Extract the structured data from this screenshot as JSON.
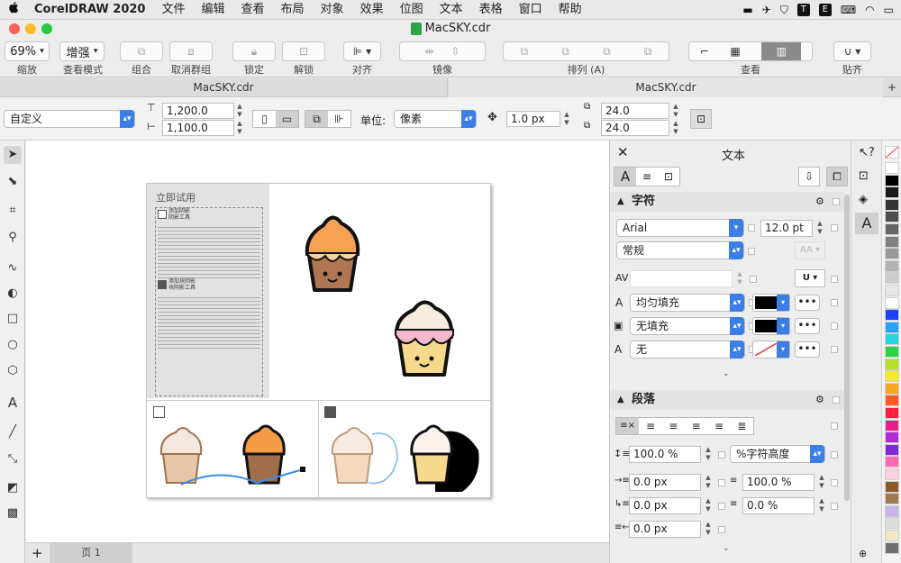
{
  "menubar": {
    "apple": "",
    "app": "CorelDRAW 2020",
    "items": [
      "文件",
      "编辑",
      "查看",
      "布局",
      "对象",
      "效果",
      "位图",
      "文本",
      "表格",
      "窗口",
      "帮助"
    ]
  },
  "window": {
    "title": "MacSKY.cdr"
  },
  "toolbar": {
    "zoom": "69%",
    "view_mode": "增强",
    "labels": {
      "zoom": "缩放",
      "view_mode": "查看模式",
      "group": "组合",
      "ungroup": "取消群组",
      "lock": "锁定",
      "unlock": "解锁",
      "align": "对齐",
      "mirror": "镜像",
      "arrange": "排列 (A)",
      "view": "查看",
      "snap": "贴齐"
    }
  },
  "tabs": [
    "MacSKY.cdr",
    "MacSKY.cdr"
  ],
  "propbar": {
    "preset": "自定义",
    "width": "1,200.0",
    "height": "1,100.0",
    "unit_label": "单位:",
    "unit": "像素",
    "nudge": "1.0 px",
    "dup_x": "24.0",
    "dup_y": "24.0"
  },
  "page_content": {
    "try_title": "立即试用",
    "tool1_title": "添加阴影\n阴影工具",
    "tool2_title": "添加块阴影\n块阴影工具"
  },
  "status": {
    "add": "+",
    "page_tab": "页 1"
  },
  "docker": {
    "title": "文本",
    "char_section": "字符",
    "font": "Arial",
    "size": "12.0 pt",
    "style": "常规",
    "uniform_fill": "均匀填充",
    "no_fill": "无填充",
    "none": "无",
    "para_section": "段落",
    "line_spacing": "100.0 %",
    "line_spacing_unit": "%字符高度",
    "indent_left": "0.0 px",
    "char_spacing": "100.0 %",
    "indent_first": "0.0 px",
    "word_spacing": "0.0 %",
    "indent_right": "0.0 px"
  },
  "colors": {
    "accent": "#3a7ee6",
    "swatches": [
      "#ffffff",
      "#000000",
      "#1a1a1a",
      "#333333",
      "#4d4d4d",
      "#666666",
      "#808080",
      "#999999",
      "#b3b3b3",
      "#cccccc",
      "#e6e6e6",
      "#ffffff",
      "#1e40ff",
      "#2aa0ff",
      "#23d6e0",
      "#2ed34a",
      "#b4e02a",
      "#f6e82a",
      "#f6a623",
      "#ff5a1f",
      "#ff1e3c",
      "#e91e8c",
      "#b02ad6",
      "#7e2ad6",
      "#ff69b4",
      "#ffd1e0",
      "#8b5a2b",
      "#a07850",
      "#c8b4e6",
      "#dcdcdc",
      "#f0e6c8",
      "#707070"
    ]
  }
}
